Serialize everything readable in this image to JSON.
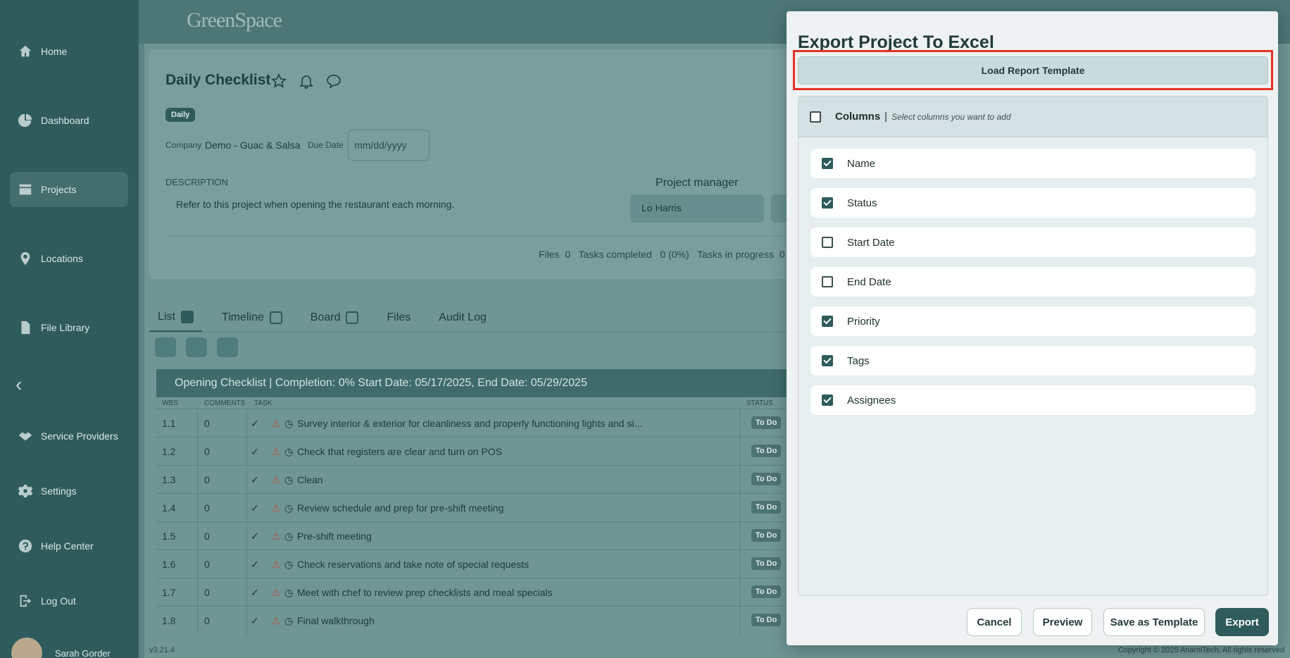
{
  "sidebar": {
    "items": [
      {
        "label": "Home",
        "icon": "home-icon"
      },
      {
        "label": "Dashboard",
        "icon": "pie-chart-icon"
      },
      {
        "label": "Projects",
        "icon": "projects-icon"
      },
      {
        "label": "Locations",
        "icon": "location-pin-icon"
      },
      {
        "label": "File Library",
        "icon": "file-icon"
      },
      {
        "label": "Service Providers",
        "icon": "handshake-icon"
      },
      {
        "label": "Settings",
        "icon": "gear-icon"
      },
      {
        "label": "Help Center",
        "icon": "help-icon"
      },
      {
        "label": "Log Out",
        "icon": "logout-icon"
      }
    ],
    "user_name": "Sarah Gorder",
    "collapse_glyph": "‹"
  },
  "app": {
    "logo": "GreenSpace",
    "version": "v3.21.4",
    "copyright": "Copyright © 2025 AnamiTech, All rights reserved"
  },
  "project": {
    "title": "Daily Checklist",
    "badge": "Daily",
    "company_label": "Company",
    "company_value": "Demo - Guac & Salsa",
    "due_date_label": "Due Date",
    "due_date_placeholder": "mm/dd/yyyy",
    "description_label": "DESCRIPTION",
    "description": "Refer to this project when opening the restaurant each morning.",
    "project_manager_label": "Project manager",
    "project_manager_value": "Lo Harris",
    "stats": "Files  0   Tasks completed   0 (0%)   Tasks in progress  0"
  },
  "tabs": [
    {
      "label": "List",
      "checkbox": true,
      "checked": true
    },
    {
      "label": "Timeline",
      "checkbox": true,
      "checked": false
    },
    {
      "label": "Board",
      "checkbox": true,
      "checked": false
    },
    {
      "label": "Files",
      "checkbox": false
    },
    {
      "label": "Audit Log",
      "checkbox": false
    }
  ],
  "table": {
    "group_title": "Opening Checklist  | Completion: 0%  Start Date: 05/17/2025, End Date: 05/29/2025",
    "headers": {
      "wbs": "WBS",
      "comments": "COMMENTS",
      "task": "TASK",
      "status": "STATUS"
    },
    "rows": [
      {
        "wbs": "1.1",
        "comments": "0",
        "task": "Survey interior & exterior for cleanliness and properly functioning lights and si...",
        "status": "To Do"
      },
      {
        "wbs": "1.2",
        "comments": "0",
        "task": "Check that registers are clear and turn on POS",
        "status": "To Do"
      },
      {
        "wbs": "1.3",
        "comments": "0",
        "task": "Clean",
        "status": "To Do"
      },
      {
        "wbs": "1.4",
        "comments": "0",
        "task": "Review schedule and prep for pre-shift meeting",
        "status": "To Do"
      },
      {
        "wbs": "1.5",
        "comments": "0",
        "task": "Pre-shift meeting",
        "status": "To Do"
      },
      {
        "wbs": "1.6",
        "comments": "0",
        "task": "Check reservations and take note of special requests",
        "status": "To Do"
      },
      {
        "wbs": "1.7",
        "comments": "0",
        "task": "Meet with chef to review prep checklists and meal specials",
        "status": "To Do"
      },
      {
        "wbs": "1.8",
        "comments": "0",
        "task": "Final walkthrough",
        "status": "To Do"
      }
    ]
  },
  "modal": {
    "title": "Export Project To Excel",
    "load_template_label": "Load Report Template",
    "columns_title": "Columns",
    "columns_separator": "|",
    "columns_hint": "Select columns you want to add",
    "columns": [
      {
        "name": "Name",
        "checked": true
      },
      {
        "name": "Status",
        "checked": true
      },
      {
        "name": "Start Date",
        "checked": false
      },
      {
        "name": "End Date",
        "checked": false
      },
      {
        "name": "Priority",
        "checked": true
      },
      {
        "name": "Tags",
        "checked": true
      },
      {
        "name": "Assignees",
        "checked": true
      }
    ],
    "buttons": {
      "cancel": "Cancel",
      "preview": "Preview",
      "save_template": "Save as Template",
      "export": "Export"
    }
  },
  "colors": {
    "accent": "#2f5b5c",
    "highlight": "#e53225",
    "modal_bg": "#eef2f2"
  }
}
